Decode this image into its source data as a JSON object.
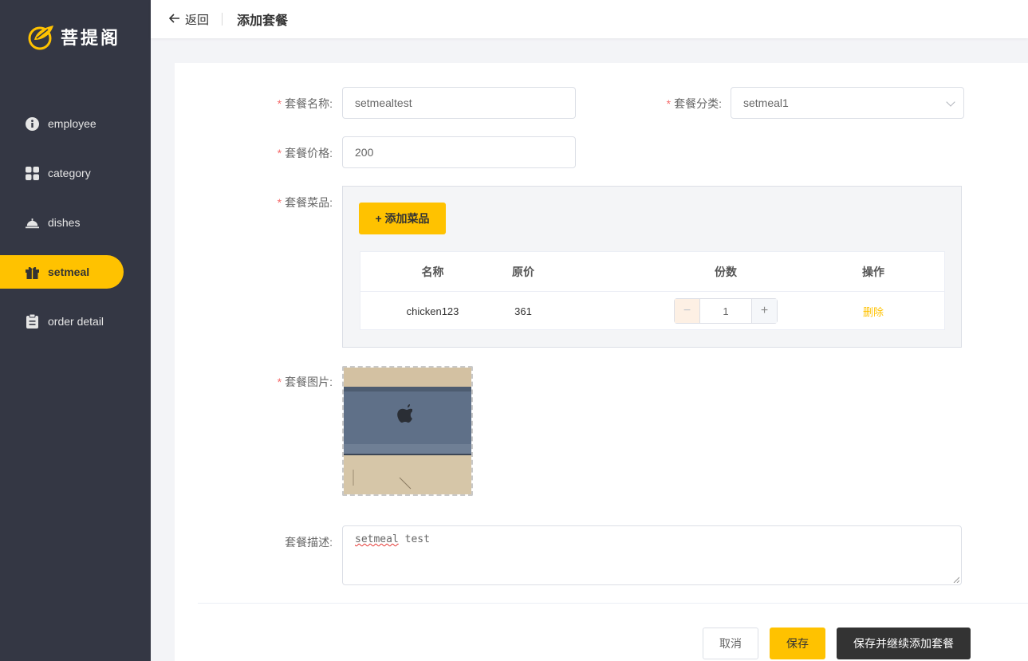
{
  "app": {
    "logo_text": "菩提阁",
    "brand_color": "#ffc200",
    "sidebar_color": "#343744"
  },
  "sidebar": {
    "items": [
      {
        "label": "employee",
        "icon": "info-icon",
        "active": false
      },
      {
        "label": "category",
        "icon": "grid-icon",
        "active": false
      },
      {
        "label": "dishes",
        "icon": "cloche-icon",
        "active": false
      },
      {
        "label": "setmeal",
        "icon": "gift-icon",
        "active": true
      },
      {
        "label": "order detail",
        "icon": "clipboard-icon",
        "active": false
      }
    ]
  },
  "header": {
    "back_label": "返回",
    "title": "添加套餐"
  },
  "form": {
    "name_label": "套餐名称:",
    "name_value": "setmealtest",
    "category_label": "套餐分类:",
    "category_value": "setmeal1",
    "price_label": "套餐价格:",
    "price_value": "200",
    "dishes_label": "套餐菜品:",
    "add_dish_label": "+ 添加菜品",
    "image_label": "套餐图片:",
    "description_label": "套餐描述:",
    "description_value_first": "setmeal",
    "description_value_rest": " test"
  },
  "dish_table": {
    "headers": [
      "名称",
      "原价",
      "份数",
      "操作"
    ],
    "rows": [
      {
        "name": "chicken123",
        "price": "361",
        "quantity": "1",
        "action": "删除"
      }
    ],
    "minus_symbol": "−",
    "plus_symbol": "+"
  },
  "footer": {
    "cancel_label": "取消",
    "save_label": "保存",
    "save_continue_label": "保存并继续添加套餐"
  }
}
